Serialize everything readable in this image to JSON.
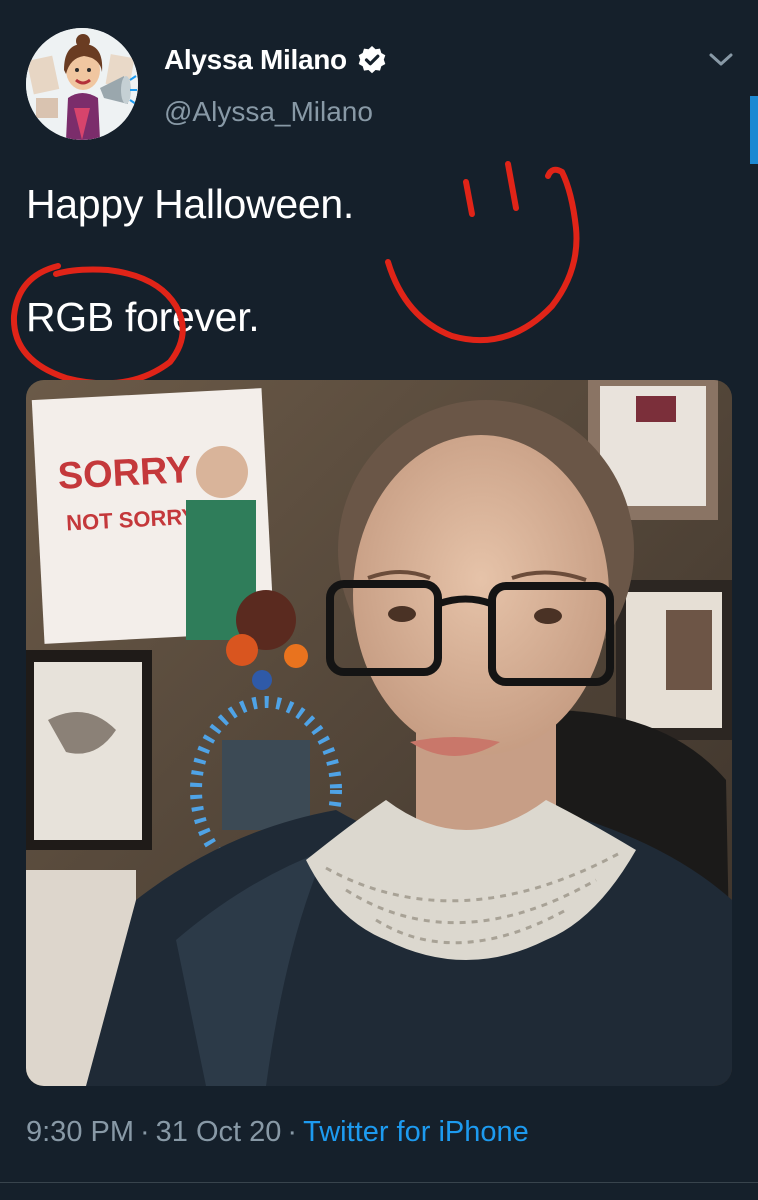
{
  "tweet": {
    "author_name": "Alyssa Milano",
    "handle": "@Alyssa_Milano",
    "lines": [
      "Happy Halloween.",
      "RGB forever."
    ],
    "time": "9:30 PM",
    "date": "31 Oct 20",
    "source": "Twitter for iPhone",
    "separator": "·"
  },
  "icons": {
    "verified": "verified-badge-icon",
    "menu": "chevron-down-icon"
  },
  "colors": {
    "background": "#15202b",
    "text": "#ffffff",
    "secondary_text": "#8899a6",
    "link": "#1d9bf0",
    "annotation": "#e02418"
  }
}
